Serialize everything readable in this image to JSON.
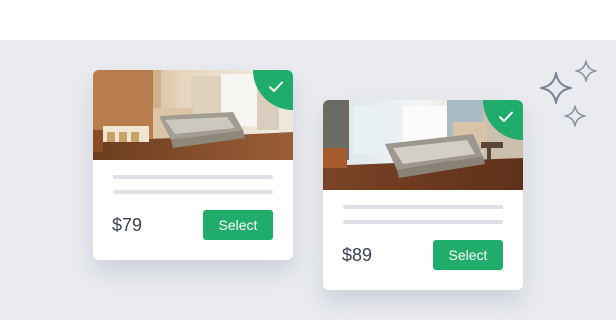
{
  "cards": [
    {
      "price": "$79",
      "select_label": "Select",
      "selected": true,
      "icons": {
        "badge": "check-icon"
      }
    },
    {
      "price": "$89",
      "select_label": "Select",
      "selected": true,
      "icons": {
        "badge": "check-icon"
      }
    }
  ],
  "colors": {
    "accent": "#20ad6b",
    "background": "#e9ebef",
    "card": "#ffffff",
    "placeholder_line": "#dde1e7",
    "price_text": "#3b4150",
    "sparkle": "#7c8294"
  },
  "decorations": {
    "icon": "sparkle-icon"
  }
}
